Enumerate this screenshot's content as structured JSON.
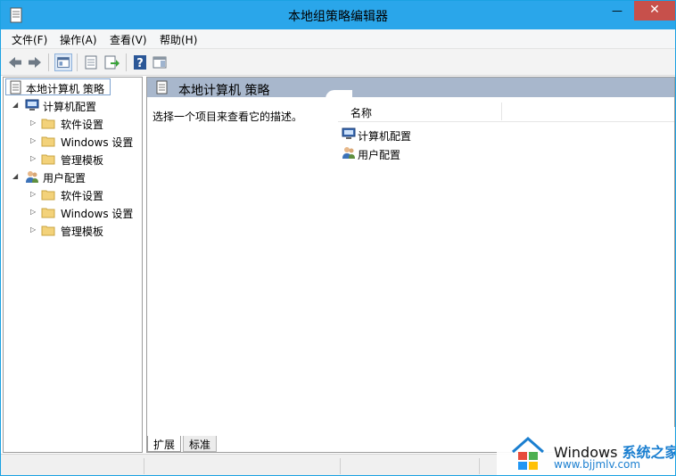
{
  "window": {
    "title": "本地组策略编辑器",
    "minimize": "—",
    "close": "✕"
  },
  "menu": [
    "文件(F)",
    "操作(A)",
    "查看(V)",
    "帮助(H)"
  ],
  "toolbar": {
    "icons": [
      "back-arrow-icon",
      "forward-arrow-icon",
      "show-hide-tree-icon",
      "properties-icon",
      "export-list-icon",
      "help-icon",
      "show-action-pane-icon"
    ]
  },
  "tree": {
    "root": "本地计算机 策略",
    "computer_config": {
      "label": "计算机配置",
      "children": [
        "软件设置",
        "Windows 设置",
        "管理模板"
      ]
    },
    "user_config": {
      "label": "用户配置",
      "children": [
        "软件设置",
        "Windows 设置",
        "管理模板"
      ]
    }
  },
  "right_pane": {
    "header": "本地计算机 策略",
    "description": "选择一个项目来查看它的描述。",
    "column_name": "名称",
    "items": [
      "计算机配置",
      "用户配置"
    ]
  },
  "tabs": {
    "expanded": "扩展",
    "standard": "标准"
  },
  "watermark": {
    "brand": "Windows",
    "accent": "系统之家",
    "url": "www.bjjmlv.com"
  },
  "colors": {
    "titlebar": "#2aa6ea",
    "close": "#c7504b",
    "pane_header": "#a8b7cc",
    "folder": "#f3d27a",
    "accent": "#1b7fd0"
  }
}
